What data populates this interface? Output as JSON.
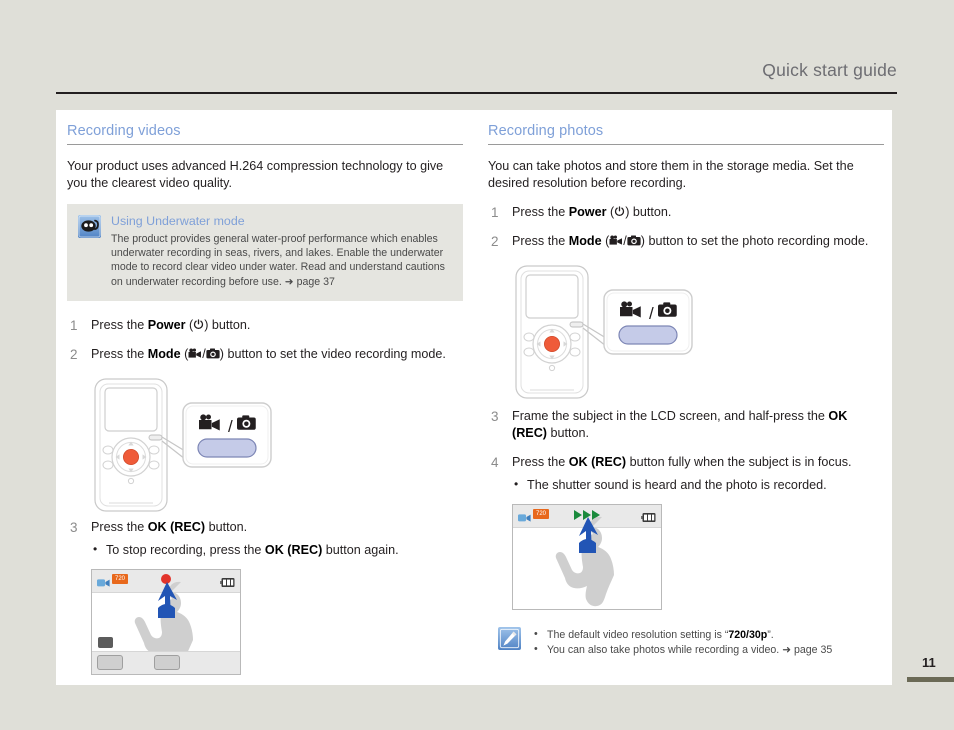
{
  "header": {
    "title": "Quick start guide"
  },
  "page": {
    "number": "11"
  },
  "left_column": {
    "section_title": "Recording videos",
    "intro": "Your product uses advanced H.264 compression technology to give you the clearest video quality.",
    "tip": {
      "icon": "snorkel-mask-icon",
      "title": "Using Underwater mode",
      "text": "The product provides general water-proof performance which enables underwater recording in seas, rivers, and lakes. Enable the underwater mode to record clear video under water. Read and understand cautions on underwater recording before use.",
      "ref": "➜ page 37"
    },
    "steps": [
      {
        "number": "1",
        "pre": "Press the ",
        "bold": "Power",
        "mid": " (",
        "icons": [
          "power-icon"
        ],
        "post": ") button."
      },
      {
        "number": "2",
        "pre": "Press the ",
        "bold": "Mode",
        "mid": " (",
        "icons": [
          "video-camera-icon",
          "photo-camera-icon"
        ],
        "post": ") button to set the video recording mode."
      },
      {
        "number": "3",
        "pre": "Press the ",
        "bold": "OK (REC)",
        "mid": "",
        "icons": [],
        "post": " button."
      }
    ],
    "step3_bullet": {
      "pre": "To stop recording, press the ",
      "bold": "OK (REC)",
      "post": " button again."
    },
    "callout_label": "mode-button-callout",
    "lcd": {
      "hd_badge": "720",
      "status": "recording"
    }
  },
  "right_column": {
    "section_title": "Recording photos",
    "intro": "You can take photos and store them in the storage media. Set the desired resolution before recording.",
    "steps": [
      {
        "number": "1",
        "pre": "Press the ",
        "bold": "Power",
        "mid": " (",
        "icons": [
          "power-icon"
        ],
        "post": ") button."
      },
      {
        "number": "2",
        "pre": "Press the ",
        "bold": "Mode",
        "mid": " (",
        "icons": [
          "video-camera-icon",
          "photo-camera-icon"
        ],
        "post": ") button to set the photo recording mode."
      },
      {
        "number": "3",
        "pre": "Frame the subject in the LCD screen, and half-press the ",
        "bold": "OK (REC)",
        "mid": "",
        "icons": [],
        "post": " button."
      },
      {
        "number": "4",
        "pre": "Press the ",
        "bold": "OK (REC)",
        "mid": "",
        "icons": [],
        "post": " button fully when the subject is in focus."
      }
    ],
    "step4_bullet": "The shutter sound is heard and the photo is recorded.",
    "callout_label": "mode-button-callout",
    "lcd": {
      "hd_badge": "720",
      "status": "fast-forward"
    },
    "note": {
      "icon": "pen-note-icon",
      "items": [
        {
          "pre": "The default video resolution setting is “",
          "bold": "720/30p",
          "post": "”."
        },
        {
          "pre": "You can also take photos while recording a video. ",
          "bold": "",
          "post": "➜ page 35"
        }
      ]
    }
  },
  "colors": {
    "page_background": "#dfdfd8",
    "sheet": "#ffffff",
    "heading_blue": "#7fa0d8",
    "body_text": "#231f20",
    "step_number": "#8b8b8b",
    "tip_background": "#e5e5e0",
    "rec_dot_red": "#e2342b",
    "hd_badge_orange": "#e8681c",
    "arrow_blue": "#2255b5",
    "ff_green": "#1a8a3c",
    "page_bar": "#6b6a56"
  }
}
